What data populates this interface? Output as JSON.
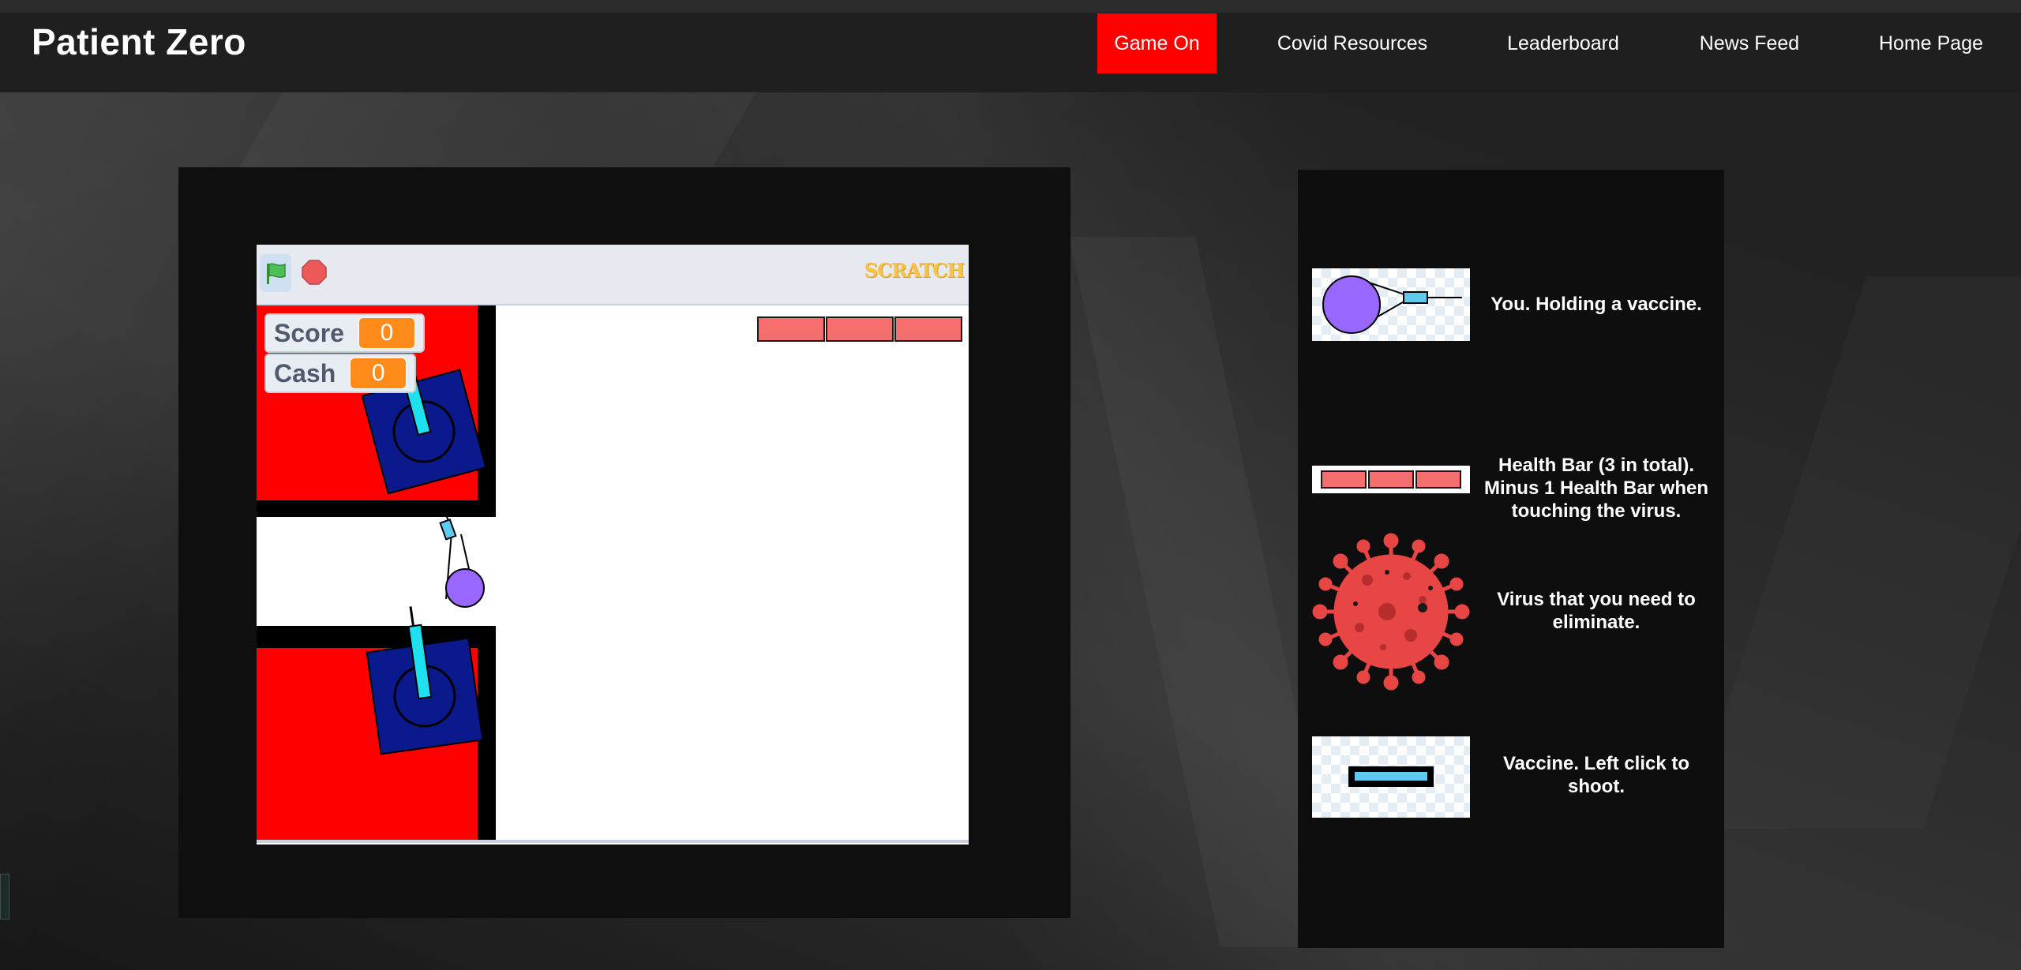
{
  "header": {
    "brand": "Patient Zero",
    "nav": [
      {
        "label": "Game On",
        "active": true
      },
      {
        "label": "Covid Resources",
        "active": false
      },
      {
        "label": "Leaderboard",
        "active": false
      },
      {
        "label": "News Feed",
        "active": false
      },
      {
        "label": "Home Page",
        "active": false
      }
    ]
  },
  "player": {
    "controls": {
      "green_flag_icon": "green-flag-icon",
      "stop_icon": "stop-sign-icon"
    },
    "logo": "SCRATCH",
    "monitors": {
      "score": {
        "label": "Score",
        "value": "0"
      },
      "cash": {
        "label": "Cash",
        "value": "0"
      }
    },
    "health_bars": 3
  },
  "legend": {
    "items": [
      {
        "icon": "player-with-vaccine-icon",
        "text": "You. Holding a vaccine."
      },
      {
        "icon": "health-bar-icon",
        "text": "Health Bar (3 in total). Minus 1 Health Bar when touching the virus."
      },
      {
        "icon": "virus-icon",
        "text": "Virus that you need to eliminate."
      },
      {
        "icon": "vaccine-icon",
        "text": "Vaccine. Left click to shoot."
      }
    ]
  },
  "colors": {
    "nav_active": "#ff0000",
    "health": "#f46e6e",
    "player": "#9966ff",
    "vaccine": "#5fc9f0",
    "virus": "#e84545",
    "monitor_value": "#ff8c1a"
  }
}
